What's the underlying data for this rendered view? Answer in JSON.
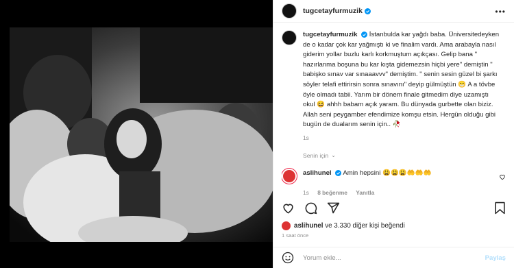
{
  "post": {
    "username": "tugcetayfurmuzik",
    "caption": "İstanbulda kar yağdı baba. Üniversitedeyken de o kadar çok kar yağmıştı ki ve finalim vardı. Ama arabayla nasıl giderim yollar buzlu karlı korkmuştum açıkçası. Gelip bana \" hazırlanma boşuna bu kar kışta gidemezsin hiçbi yere\" demiştin \" babişko sınav var sınaaavvv\" demiştim. \" senin sesin güzel bi şarkı söyler telafi ettirirsin sonra sınavını\" deyip gülmüştün 😁 A a tövbe öyle olmadı tabii. Yarım bir dönem finale gitmedim diye uzamıştı okul 😆 ahhh babam açık yaram. Bu dünyada gurbette olan biziz. Allah seni peygamber efendimize komşu etsin. Hergün olduğu gibi bugün de dualarım senin için.. 🥀",
    "caption_time": "1s",
    "see_for_you": "Senin için",
    "comment": {
      "username": "aslihunel",
      "text": "Amin hepsini 😩😩😩🤲🤲🤲",
      "time": "1s",
      "likes": "8 beğenme",
      "reply": "Yanıtla"
    },
    "likes_user": "aslihunel",
    "likes_rest": "ve 3.330 diğer kişi beğendi",
    "posted_ago": "1 saat önce",
    "comment_placeholder": "Yorum ekle...",
    "share_label": "Paylaş"
  },
  "colors": {
    "verified": "#0095f6",
    "link_disabled": "#b2dffc",
    "muted": "#8e8e8e"
  },
  "icons": [
    "verified-icon",
    "more-icon",
    "heart-icon",
    "comment-icon",
    "share-icon",
    "bookmark-icon",
    "emoji-icon",
    "chevron-down-icon"
  ]
}
